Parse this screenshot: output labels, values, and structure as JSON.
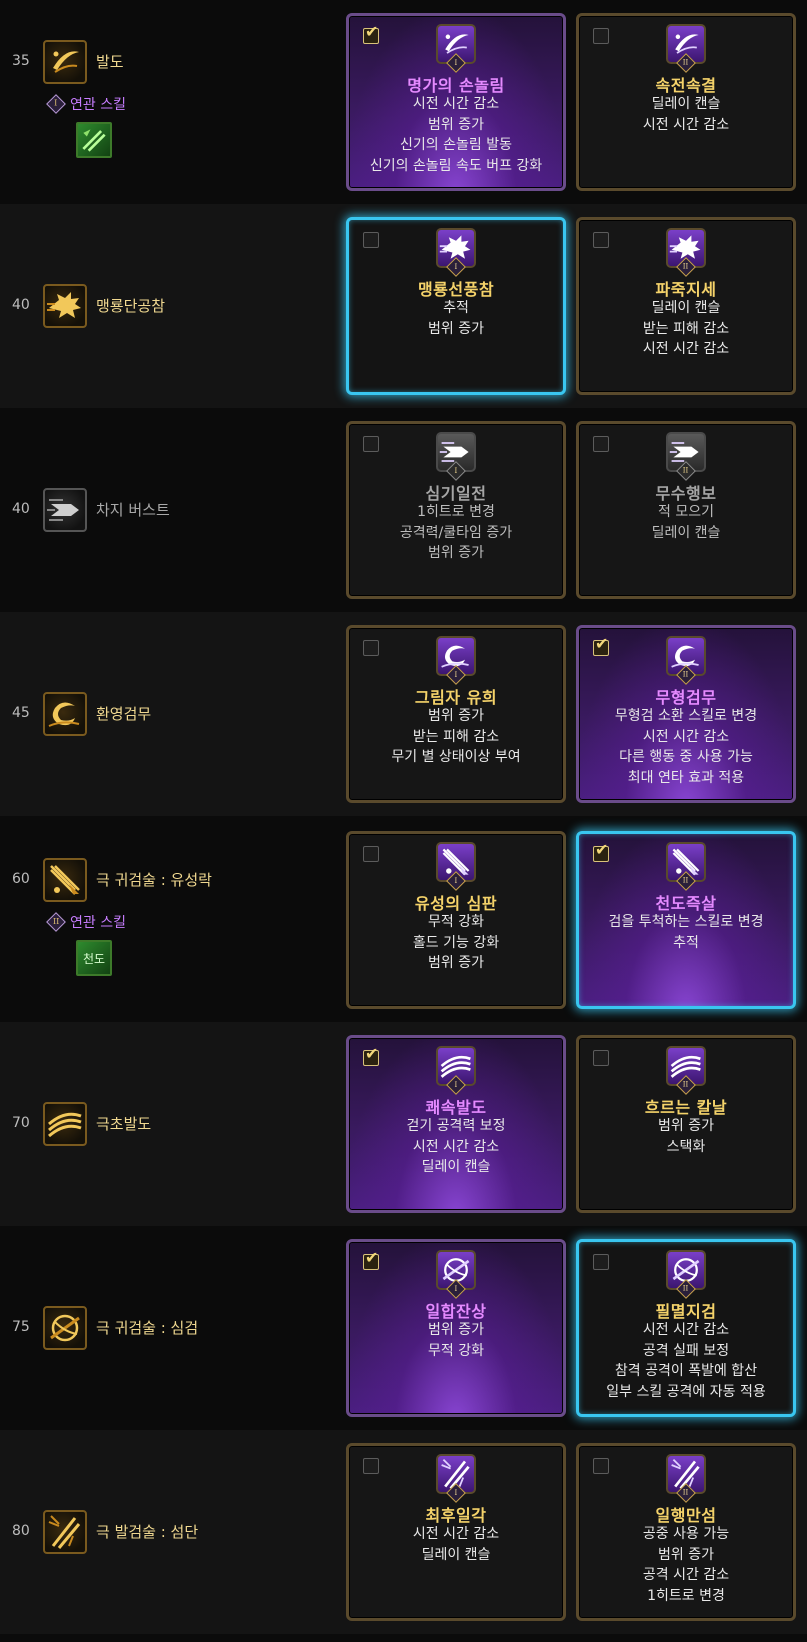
{
  "rows": [
    {
      "level": "35",
      "skill_name": "발도",
      "skill_icon": "crescent-slash-icon",
      "gray": false,
      "related": {
        "label": "연관 스킬",
        "roman": "I",
        "icon": "green-sword-icon",
        "icon_text": ""
      },
      "cards": [
        {
          "checked": true,
          "roman": "I",
          "icon": "crescent-slash-rune-icon",
          "title": "명가의 손놀림",
          "effects": [
            "시전 시간 감소",
            "범위 증가",
            "신기의 손놀림 발동",
            "신기의 손놀림 속도 버프 강화"
          ]
        },
        {
          "checked": false,
          "roman": "II",
          "icon": "crescent-slash-rune-icon",
          "title": "속전속결",
          "effects": [
            "딜레이 캔슬",
            "시전 시간 감소"
          ]
        }
      ]
    },
    {
      "level": "40",
      "skill_name": "맹룡단공참",
      "skill_icon": "dragon-head-icon",
      "gray": false,
      "cards": [
        {
          "checked": false,
          "roman": "I",
          "icon": "dragon-rune-icon",
          "title": "맹룡선풍참",
          "effects": [
            "추적",
            "범위 증가"
          ]
        },
        {
          "checked": false,
          "roman": "II",
          "icon": "dragon-rune-icon",
          "title": "파죽지세",
          "effects": [
            "딜레이 캔슬",
            "받는 피해 감소",
            "시전 시간 감소"
          ]
        }
      ]
    },
    {
      "level": "40",
      "skill_name": "차지 버스트",
      "skill_icon": "charge-burst-icon",
      "gray": true,
      "cards": [
        {
          "checked": false,
          "roman": "I",
          "icon": "charge-burst-rune-icon",
          "title": "심기일전",
          "effects": [
            "1히트로 변경",
            "공격력/쿨타임 증가",
            "범위 증가"
          ]
        },
        {
          "checked": false,
          "roman": "II",
          "icon": "charge-burst-rune-icon",
          "title": "무수행보",
          "effects": [
            "적 모으기",
            "딜레이 캔슬"
          ]
        }
      ]
    },
    {
      "level": "45",
      "skill_name": "환영검무",
      "skill_icon": "phantom-swirl-icon",
      "gray": false,
      "cards": [
        {
          "checked": false,
          "roman": "I",
          "icon": "swirl-rune-icon",
          "title": "그림자 유희",
          "effects": [
            "범위 증가",
            "받는 피해 감소",
            "무기 별 상태이상 부여"
          ]
        },
        {
          "checked": true,
          "roman": "II",
          "icon": "swirl-rune-icon",
          "title": "무형검무",
          "effects": [
            "무형검 소환 스킬로 변경",
            "시전 시간 감소",
            "다른 행동 중 사용 가능",
            "최대 연타 효과 적용"
          ]
        }
      ]
    },
    {
      "level": "60",
      "skill_name": "극 귀검술 : 유성락",
      "skill_icon": "meteor-sword-icon",
      "gray": false,
      "related": {
        "label": "연관 스킬",
        "roman": "II",
        "icon": "green-glyph-icon",
        "icon_text": "천도"
      },
      "cards": [
        {
          "checked": false,
          "roman": "I",
          "icon": "meteor-rune-icon",
          "title": "유성의 심판",
          "effects": [
            "무적 강화",
            "홀드 기능 강화",
            "범위 증가"
          ]
        },
        {
          "checked": true,
          "roman": "II",
          "icon": "meteor-rune-icon",
          "title": "천도즉살",
          "effects": [
            "검을 투척하는 스킬로 변경",
            "추적"
          ]
        }
      ]
    },
    {
      "level": "70",
      "skill_name": "극초발도",
      "skill_icon": "triple-slash-icon",
      "gray": false,
      "cards": [
        {
          "checked": true,
          "roman": "I",
          "icon": "triple-slash-rune-icon",
          "title": "쾌속발도",
          "effects": [
            "걷기 공격력 보정",
            "시전 시간 감소",
            "딜레이 캔슬"
          ]
        },
        {
          "checked": false,
          "roman": "II",
          "icon": "triple-slash-rune-icon",
          "title": "흐르는 칼날",
          "effects": [
            "범위 증가",
            "스택화"
          ]
        }
      ]
    },
    {
      "level": "75",
      "skill_name": "극 귀검술 : 심검",
      "skill_icon": "heart-sword-icon",
      "gray": false,
      "cards": [
        {
          "checked": true,
          "roman": "I",
          "icon": "heart-sword-rune-icon",
          "title": "일합잔상",
          "effects": [
            "범위 증가",
            "무적 강화"
          ]
        },
        {
          "checked": false,
          "roman": "II",
          "icon": "heart-sword-rune-icon",
          "title": "필멸지검",
          "effects": [
            "시전 시간 감소",
            "공격 실패 보정",
            "참격 공격이 폭발에 합산",
            "일부 스킬 공격에 자동 적용"
          ]
        }
      ]
    },
    {
      "level": "80",
      "skill_name": "극 발검술 : 섬단",
      "skill_icon": "flash-cut-icon",
      "gray": false,
      "cards": [
        {
          "checked": false,
          "roman": "I",
          "icon": "flash-cut-rune-icon",
          "title": "최후일각",
          "effects": [
            "시전 시간 감소",
            "딜레이 캔슬"
          ]
        },
        {
          "checked": false,
          "roman": "II",
          "icon": "flash-cut-rune-icon",
          "title": "일행만섬",
          "effects": [
            "공중 사용 가능",
            "범위 증가",
            "공격 시간 감소",
            "1히트로 변경"
          ]
        }
      ]
    }
  ]
}
